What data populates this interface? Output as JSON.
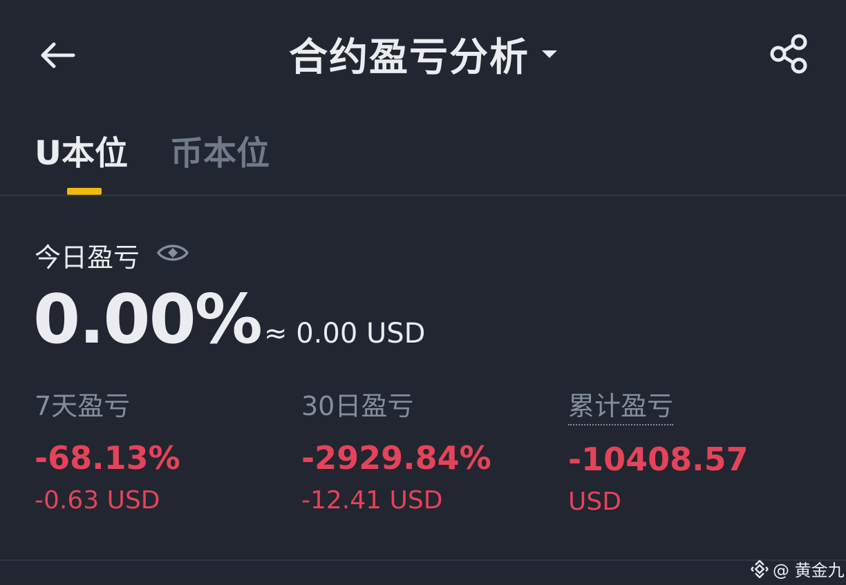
{
  "header": {
    "title": "合约盈亏分析",
    "back_icon": "arrow-left-icon",
    "share_icon": "share-icon",
    "dropdown_icon": "caret-down-icon"
  },
  "tabs": [
    {
      "label": "U本位",
      "active": true
    },
    {
      "label": "币本位",
      "active": false
    }
  ],
  "today": {
    "label": "今日盈亏",
    "percent": "0.00%",
    "approx_usd": "≈ 0.00 USD",
    "visibility_icon": "eye-icon"
  },
  "stats": [
    {
      "label": "7天盈亏",
      "percent": "-68.13%",
      "usd": "-0.63 USD"
    },
    {
      "label": "30日盈亏",
      "percent": "-2929.84%",
      "usd": "-12.41 USD"
    },
    {
      "label": "累计盈亏",
      "percent": "-10408.57",
      "usd": "USD"
    }
  ],
  "watermark": {
    "text": "@ 黄金九"
  },
  "colors": {
    "background": "#222630",
    "primary_text": "#EAECEF",
    "secondary_text": "#848E9C",
    "loss": "#F6465D",
    "accent": "#F0B90B"
  }
}
